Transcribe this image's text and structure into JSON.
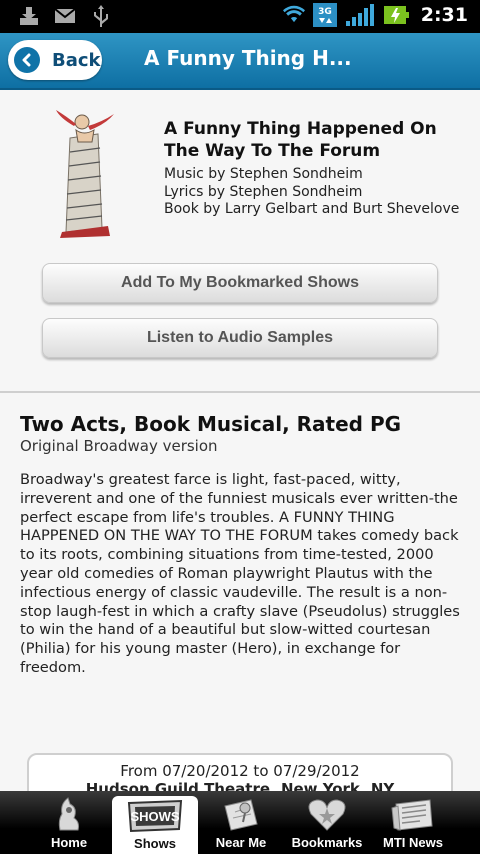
{
  "status_bar": {
    "time": "2:31",
    "network": "3G",
    "icons": [
      "download-icon",
      "gmail-icon",
      "usb-icon",
      "wifi-icon",
      "3g-icon",
      "signal-icon",
      "battery-charging-icon"
    ]
  },
  "header": {
    "back_label": "Back",
    "title": "A Funny Thing H..."
  },
  "show": {
    "title": "A Funny Thing Happened On The Way To The Forum",
    "credits": [
      "Music by Stephen Sondheim",
      "Lyrics by Stephen Sondheim",
      "Book by Larry Gelbart and Burt Shevelove"
    ]
  },
  "actions": {
    "bookmark_label": "Add To My Bookmarked Shows",
    "audio_label": "Listen to Audio Samples"
  },
  "details": {
    "heading": "Two Acts, Book Musical, Rated PG",
    "version": "Original Broadway version",
    "description": "Broadway's greatest farce is light, fast-paced, witty, irreverent and one of the funniest musicals ever written-the perfect escape from life's troubles. A FUNNY THING HAPPENED ON THE WAY TO THE FORUM takes comedy back to its roots, combining situations from time-tested, 2000 year old comedies of Roman playwright Plautus with the infectious energy of classic vaudeville. The result is a non-stop laugh-fest in which a crafty slave (Pseudolus) struggles to win the hand of a beautiful but slow-witted courtesan (Philia) for his young master (Hero), in exchange for freedom."
  },
  "production": {
    "dates": "From 07/20/2012 to 07/29/2012",
    "venue": "Hudson Guild Theatre, New York, NY"
  },
  "tabs": [
    {
      "label": "Home",
      "active": false
    },
    {
      "label": "Shows",
      "active": true
    },
    {
      "label": "Near Me",
      "active": false
    },
    {
      "label": "Bookmarks",
      "active": false
    },
    {
      "label": "MTI News",
      "active": false
    }
  ],
  "colors": {
    "header_blue": "#1a84b8",
    "back_text": "#0f4e78",
    "tabbar_bg": "#000000"
  }
}
